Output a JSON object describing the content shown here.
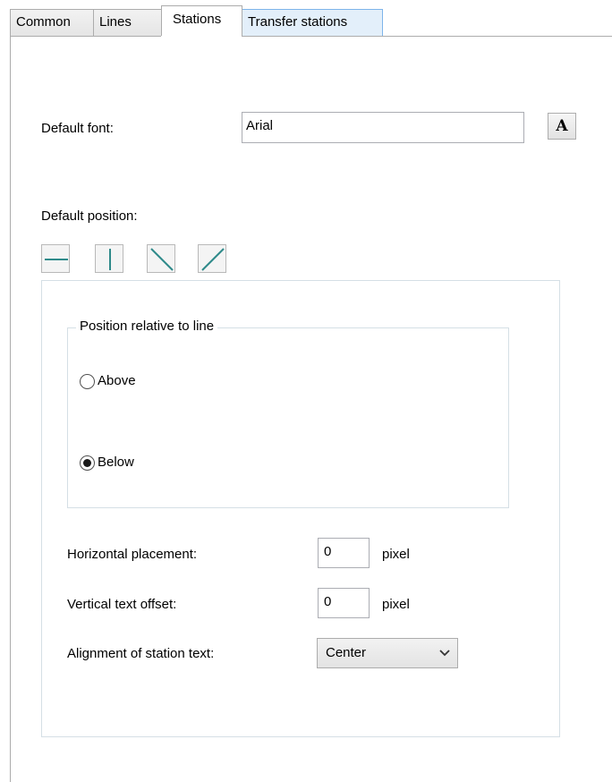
{
  "tabs": [
    {
      "label": "Common"
    },
    {
      "label": "Lines"
    },
    {
      "label": "Stations"
    },
    {
      "label": "Transfer stations"
    }
  ],
  "active_tab": "Stations",
  "default_font": {
    "label": "Default font:",
    "value": "Arial",
    "button_glyph": "A",
    "button_icon": "font-icon"
  },
  "default_position": {
    "label": "Default position:",
    "buttons": [
      {
        "icon": "horizontal-line-icon"
      },
      {
        "icon": "vertical-line-icon"
      },
      {
        "icon": "diagonal-down-icon"
      },
      {
        "icon": "diagonal-up-icon"
      }
    ]
  },
  "relative": {
    "title": "Position relative to line",
    "options": [
      {
        "label": "Above",
        "selected": false
      },
      {
        "label": "Below",
        "selected": true
      }
    ]
  },
  "horizontal": {
    "label": "Horizontal placement:",
    "value": "0",
    "unit": "pixel"
  },
  "vertical": {
    "label": "Vertical text offset:",
    "value": "0",
    "unit": "pixel"
  },
  "alignment": {
    "label": "Alignment of station text:",
    "value": "Center"
  },
  "colors": {
    "accent": "#2f8a8a",
    "border": "#acacac",
    "hover_tab": "#e3effa"
  }
}
